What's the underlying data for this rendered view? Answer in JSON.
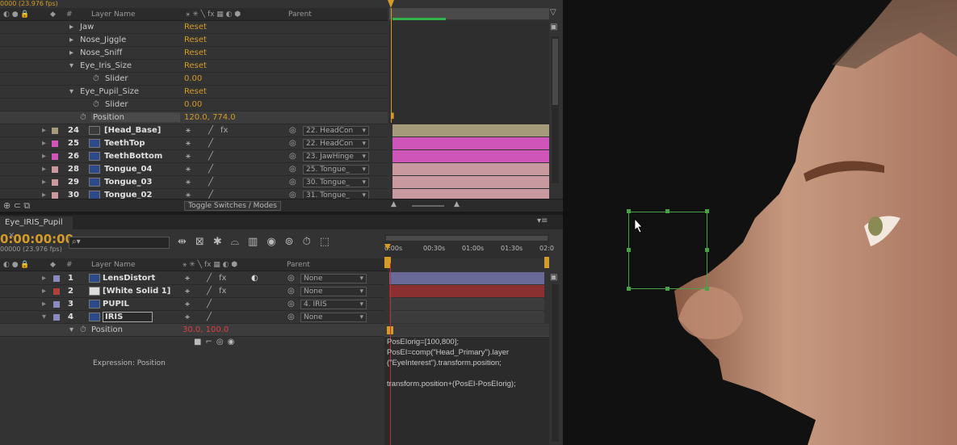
{
  "top_panel": {
    "timecode_partial": "0000 (23.976 fps)",
    "col_layer_name": "Layer Name",
    "col_parent": "Parent",
    "props": [
      {
        "name": "Jaw",
        "value": "Reset"
      },
      {
        "name": "Nose_Jiggle",
        "value": "Reset"
      },
      {
        "name": "Nose_Sniff",
        "value": "Reset"
      },
      {
        "name": "Eye_Iris_Size",
        "value": "Reset"
      },
      {
        "name": "Slider",
        "value": "0.00"
      },
      {
        "name": "Eye_Pupil_Size",
        "value": "Reset"
      },
      {
        "name": "Slider",
        "value": "0.00"
      },
      {
        "name": "Position",
        "value": "120.0, 774.0"
      }
    ],
    "layers": [
      {
        "num": "24",
        "name": "[Head_Base]",
        "parent": "22. HeadCon",
        "color": "#a59a7a"
      },
      {
        "num": "25",
        "name": "TeethTop",
        "parent": "22. HeadCon",
        "color": "#d055b8"
      },
      {
        "num": "26",
        "name": "TeethBottom",
        "parent": "23. JawHinge",
        "color": "#d055b8"
      },
      {
        "num": "28",
        "name": "Tongue_04",
        "parent": "25. Tongue_",
        "color": "#c89aa0"
      },
      {
        "num": "29",
        "name": "Tongue_03",
        "parent": "30. Tongue_",
        "color": "#c89aa0"
      },
      {
        "num": "30",
        "name": "Tongue_02",
        "parent": "31. Tongue_",
        "color": "#c89aa0"
      }
    ],
    "toggle_label": "Toggle Switches / Modes"
  },
  "bottom_panel": {
    "tab": "Eye_IRIS_Pupil",
    "timecode": "0:00:00:00",
    "fps": "00000 (23.976 fps)",
    "col_layer_name": "Layer Name",
    "col_parent": "Parent",
    "ruler": [
      "0:00s",
      "00:30s",
      "01:00s",
      "01:30s",
      "02:0"
    ],
    "layers": [
      {
        "num": "1",
        "name": "LensDistort",
        "parent": "None",
        "color": "#8a8abf",
        "fx": true
      },
      {
        "num": "2",
        "name": "[White Solid 1]",
        "parent": "None",
        "color": "#b04040",
        "fx": true
      },
      {
        "num": "3",
        "name": "PUPIL",
        "parent": "4. IRIS",
        "color": "#8a8abf",
        "fx": false
      },
      {
        "num": "4",
        "name": "IRIS",
        "parent": "None",
        "color": "#8a8abf",
        "fx": false
      }
    ],
    "position_label": "Position",
    "position_value": "30.0, 100.0",
    "expression_label": "Expression: Position",
    "expression_lines": [
      "PosEIorig=[100,800];",
      "PosEI=comp(\"Head_Primary\").layer",
      "(\"EyeInterest\").transform.position;",
      "",
      "transform.position+(PosEI-PosEIorig);"
    ]
  },
  "colors": {
    "accent": "#d49b28",
    "panel": "#333333",
    "selection": "#3c3c3c"
  }
}
